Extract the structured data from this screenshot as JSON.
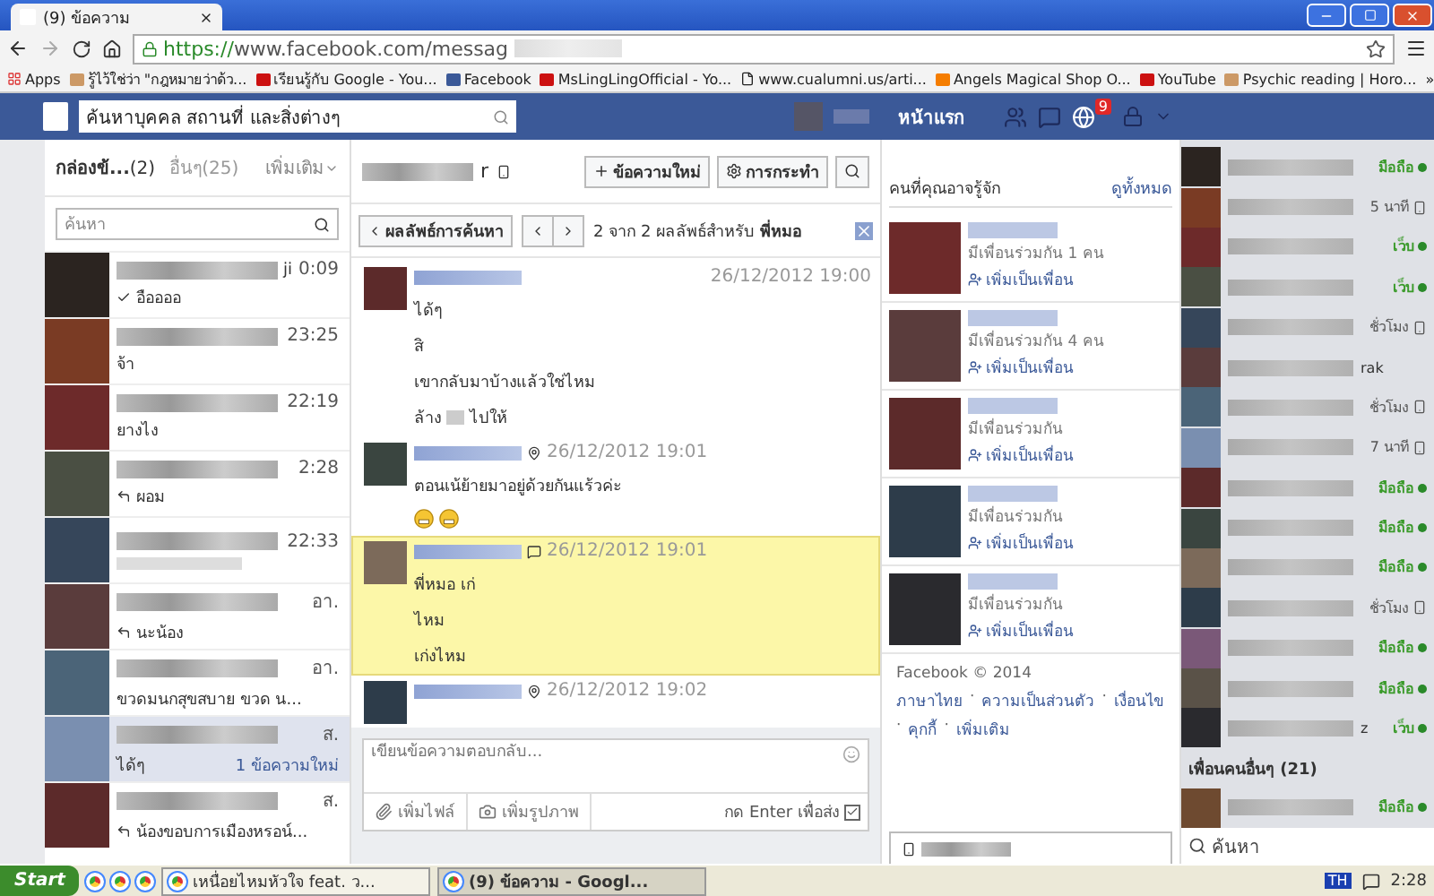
{
  "browser": {
    "tab_title": "(9) ข้อความ",
    "url_secure": "https://",
    "url_rest": "www.facebook.com/messag",
    "bookmarks": [
      {
        "label": "Apps",
        "kind": "apps"
      },
      {
        "label": "รู้ไว้ใช่ว่า \"กฎหมายว่าด้ว...",
        "kind": "other"
      },
      {
        "label": "เรียนรู้กับ Google - You...",
        "kind": "youtube"
      },
      {
        "label": "Facebook",
        "kind": "facebook"
      },
      {
        "label": "MsLingLingOfficial - Yo...",
        "kind": "youtube"
      },
      {
        "label": "www.cualumni.us/arti...",
        "kind": "page"
      },
      {
        "label": "Angels Magical Shop O...",
        "kind": "blogger"
      },
      {
        "label": "YouTube",
        "kind": "youtube"
      },
      {
        "label": "Psychic reading | Horo...",
        "kind": "other"
      }
    ],
    "bookmarks_more": "»"
  },
  "topbar": {
    "search_placeholder": "ค้นหาบุคคล สถานที่ และสิ่งต่างๆ",
    "home": "หน้าแรก",
    "notification_count": "9"
  },
  "inbox": {
    "tabs": [
      {
        "label": "กล่องข้...",
        "count": "(2)",
        "selected": true
      },
      {
        "label": "อื่นๆ",
        "count": "(25)",
        "selected": false
      }
    ],
    "more": "เพิ่มเติม",
    "search_placeholder": "ค้นหา",
    "threads": [
      {
        "name_tail": "ji",
        "time": "0:09",
        "snippet": "อืออออ",
        "kind": "seen",
        "selected": false
      },
      {
        "time": "23:25",
        "snippet": "จ้า",
        "kind": "plain",
        "selected": false
      },
      {
        "time": "22:19",
        "snippet": "ยางไง",
        "kind": "plain",
        "selected": false
      },
      {
        "time": "2:28",
        "snippet": "ผอม",
        "kind": "replied",
        "selected": false
      },
      {
        "time": "22:33",
        "kind": "plain",
        "selected": false
      },
      {
        "time": "อา.",
        "snippet": "นะน้อง",
        "kind": "replied",
        "selected": false
      },
      {
        "time": "อา.",
        "snippet": "ขวดมนกสุขสบาย ขวด น...",
        "kind": "plain",
        "selected": false
      },
      {
        "time": "ส.",
        "snippet": "ได้ๆ",
        "kind": "plain",
        "selected": true,
        "new_label": "1 ข้อความใหม่"
      },
      {
        "time": "ส.",
        "snippet": "น้องขอบการเมืองหรอน์...",
        "kind": "replied",
        "selected": false
      }
    ]
  },
  "conversation": {
    "name_tail": "r",
    "new_message": "ข้อความใหม่",
    "actions": "การกระทำ",
    "search_back": "ผลลัพธ์การค้นหา",
    "search_result": "2 จาก 2 ผลลัพธ์สำหรับ **พี่หมอ**",
    "messages": [
      {
        "time": "26/12/2012 19:00",
        "kind": "plain",
        "highlighted": false,
        "lines": [
          "ได้ๆ",
          "สิ",
          "เขากลับมาบ้างแล้วใช่ไหม",
          [
            "ล้าง",
            "ไปให้"
          ]
        ],
        "emoji": false
      },
      {
        "time": "26/12/2012 19:01",
        "kind": "mobile",
        "highlighted": false,
        "lines": [
          "ตอนเน้ย้ายมาอยู่ด้วยกันแร้วค่ะ"
        ],
        "emoji": true
      },
      {
        "time": "26/12/2012 19:01",
        "kind": "chat",
        "highlighted": true,
        "lines": [
          "พี่หมอ เก่",
          "ไหม",
          "เก่งไหม"
        ],
        "emoji": false
      },
      {
        "time": "26/12/2012 19:02",
        "kind": "mobile",
        "highlighted": false,
        "emoji": false
      }
    ],
    "compose": {
      "placeholder": "เขียนข้อความตอบกลับ...",
      "add_file": "เพิ่มไฟล์",
      "add_photo": "เพิ่มรูปภาพ",
      "enter_label": "กด Enter เพื่อส่ง",
      "enter_checked": true
    }
  },
  "suggestions": {
    "title": "คนที่คุณอาจรู้จัก",
    "see_all": "ดูทั้งหมด",
    "people": [
      {
        "mutual": "มีเพื่อนร่วมกัน 1 คน",
        "add": "เพิ่มเป็นเพื่อน"
      },
      {
        "mutual": "มีเพื่อนร่วมกัน 4 คน",
        "add": "เพิ่มเป็นเพื่อน"
      },
      {
        "mutual": "มีเพื่อนร่วมกัน",
        "add": "เพิ่มเป็นเพื่อน"
      },
      {
        "mutual": "มีเพื่อนร่วมกัน",
        "add": "เพิ่มเป็นเพื่อน"
      },
      {
        "mutual": "มีเพื่อนร่วมกัน",
        "add": "เพิ่มเป็นเพื่อน"
      }
    ],
    "copyright": "Facebook © 2014",
    "links": [
      "ภาษาไทย",
      "ความเป็นส่วนตัว",
      "เงื่อนไข",
      "คุกกี้",
      "เพิ่มเติม"
    ],
    "link_separator": "·"
  },
  "chat": {
    "friends": [
      {
        "status": "มือถือ",
        "kind": "online"
      },
      {
        "status": "5 นาที",
        "kind": "away"
      },
      {
        "status": "เว็บ",
        "kind": "online"
      },
      {
        "status": "เว็บ",
        "kind": "online"
      },
      {
        "status": "ชั่วโมง",
        "kind": "away"
      },
      {
        "name_tail": "rak"
      },
      {
        "status": "ชั่วโมง",
        "kind": "away"
      },
      {
        "status": "7 นาที",
        "kind": "away"
      },
      {
        "status": "มือถือ",
        "kind": "online"
      },
      {
        "status": "มือถือ",
        "kind": "online"
      },
      {
        "status": "มือถือ",
        "kind": "online"
      },
      {
        "status": "ชั่วโมง",
        "kind": "away"
      },
      {
        "status": "มือถือ",
        "kind": "online"
      },
      {
        "status": "มือถือ",
        "kind": "online"
      },
      {
        "name_tail": "z",
        "status": "เว็บ",
        "kind": "online"
      }
    ],
    "others_title": "เพื่อนคนอื่นๆ (21)",
    "others": [
      {
        "status": "มือถือ",
        "kind": "online"
      }
    ],
    "search_placeholder": "ค้นหา"
  },
  "taskbar": {
    "start": "Start",
    "tasks": [
      {
        "label": "เหนื่อยไหมหัวใจ feat. ว...",
        "selected": false
      },
      {
        "label": "(9) ข้อความ - Googl...",
        "selected": true
      }
    ],
    "language": "TH",
    "clock": "2:28"
  }
}
